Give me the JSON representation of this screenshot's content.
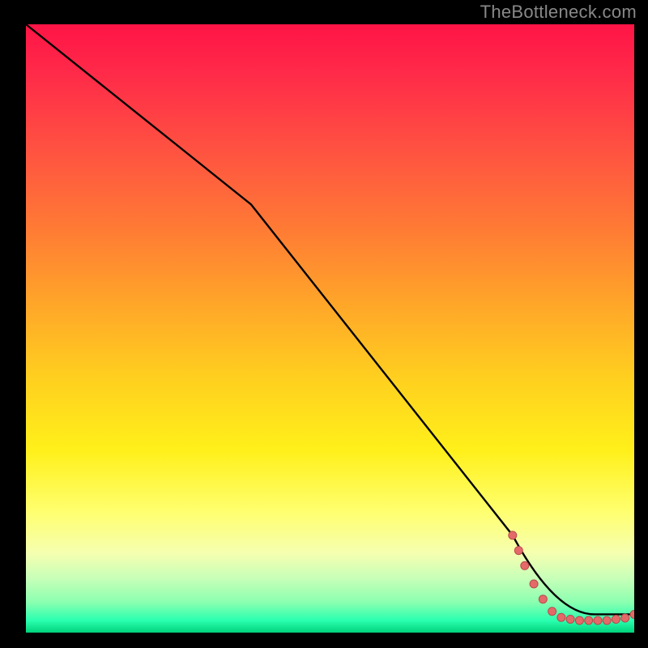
{
  "watermark": "TheBottleneck.com",
  "colors": {
    "line": "#000000",
    "marker_fill": "#e46a6a",
    "marker_stroke": "#b94a4a",
    "background_top": "#ff1446",
    "background_bottom": "#00d27a"
  },
  "chart_data": {
    "type": "line",
    "title": "",
    "xlabel": "",
    "ylabel": "",
    "xlim": [
      0,
      100
    ],
    "ylim": [
      0,
      100
    ],
    "grid": false,
    "legend": false,
    "line_path": [
      {
        "x": 0,
        "y": 100
      },
      {
        "x": 25,
        "y": 80
      },
      {
        "x": 80,
        "y": 16
      },
      {
        "x": 87,
        "y": 3
      },
      {
        "x": 100,
        "y": 3
      }
    ],
    "scatter_points": [
      {
        "x": 80.0,
        "y": 16.0
      },
      {
        "x": 81.0,
        "y": 13.5
      },
      {
        "x": 82.0,
        "y": 11.0
      },
      {
        "x": 83.5,
        "y": 8.0
      },
      {
        "x": 85.0,
        "y": 5.5
      },
      {
        "x": 86.5,
        "y": 3.5
      },
      {
        "x": 88.0,
        "y": 2.5
      },
      {
        "x": 89.5,
        "y": 2.2
      },
      {
        "x": 91.0,
        "y": 2.0
      },
      {
        "x": 92.5,
        "y": 2.0
      },
      {
        "x": 94.0,
        "y": 2.0
      },
      {
        "x": 95.5,
        "y": 2.0
      },
      {
        "x": 97.0,
        "y": 2.2
      },
      {
        "x": 98.5,
        "y": 2.4
      },
      {
        "x": 100.0,
        "y": 3.0
      }
    ],
    "marker_radius_px": 5
  }
}
